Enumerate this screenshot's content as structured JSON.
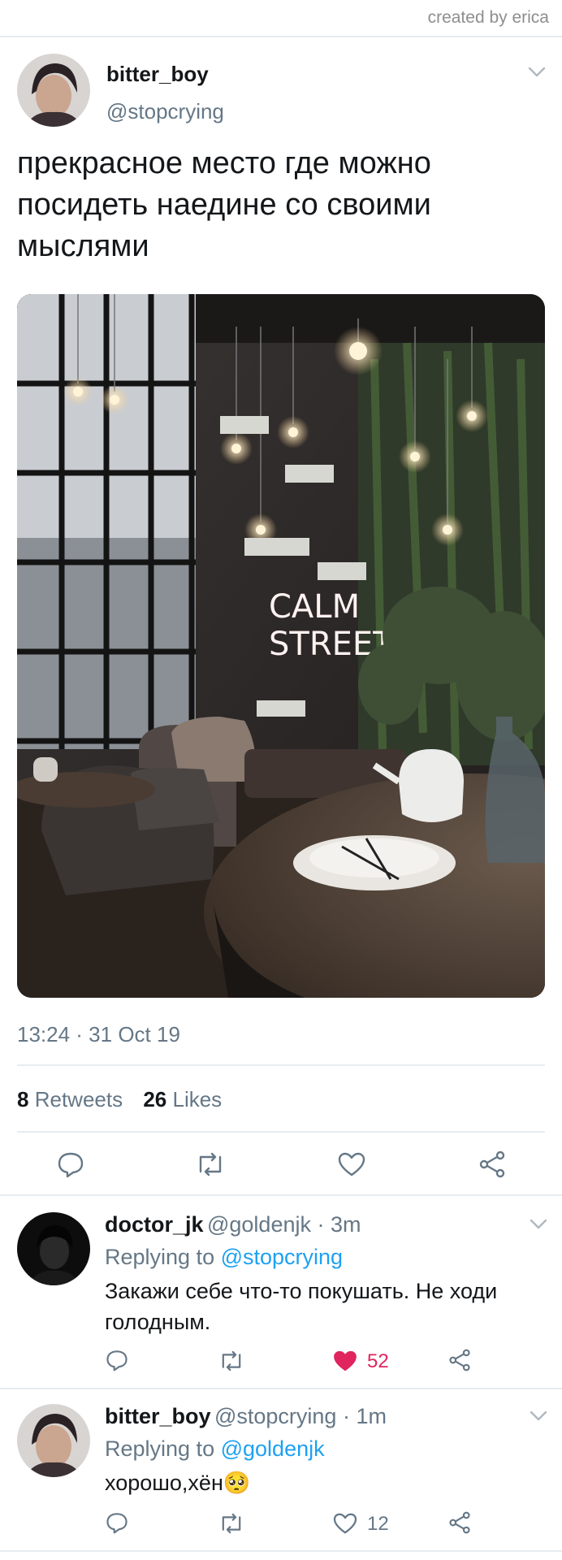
{
  "credit": "created by erica",
  "tweet": {
    "name": "bitter_boy",
    "handle": "@stopcrying",
    "text": "прекрасное место где можно посидеть наедине со своими мыслями",
    "time": "13:24 · 31 Oct 19",
    "retweets_count": "8",
    "retweets_label": "Retweets",
    "likes_count": "26",
    "likes_label": "Likes",
    "photo_sign_line1": "CALM",
    "photo_sign_line2": "STREET"
  },
  "replies": [
    {
      "name": "doctor_jk",
      "meta": "@goldenjk · 3m",
      "replying_label": "Replying to",
      "replying_to": "@stopcrying",
      "text": "Закажи себе что-то покушать. Не ходи голодным.",
      "like_count": "52",
      "liked": true
    },
    {
      "name": "bitter_boy",
      "meta": "@stopcrying · 1m",
      "replying_label": "Replying to",
      "replying_to": "@goldenjk",
      "text": "хорошо,хён",
      "emoji": "🥺",
      "like_count": "12",
      "liked": false
    }
  ],
  "colors": {
    "accent": "#1da1f2",
    "like": "#e0245e",
    "muted": "#657786"
  },
  "icons": [
    "comment-icon",
    "retweet-icon",
    "heart-icon",
    "share-icon",
    "chevron-down-icon"
  ]
}
